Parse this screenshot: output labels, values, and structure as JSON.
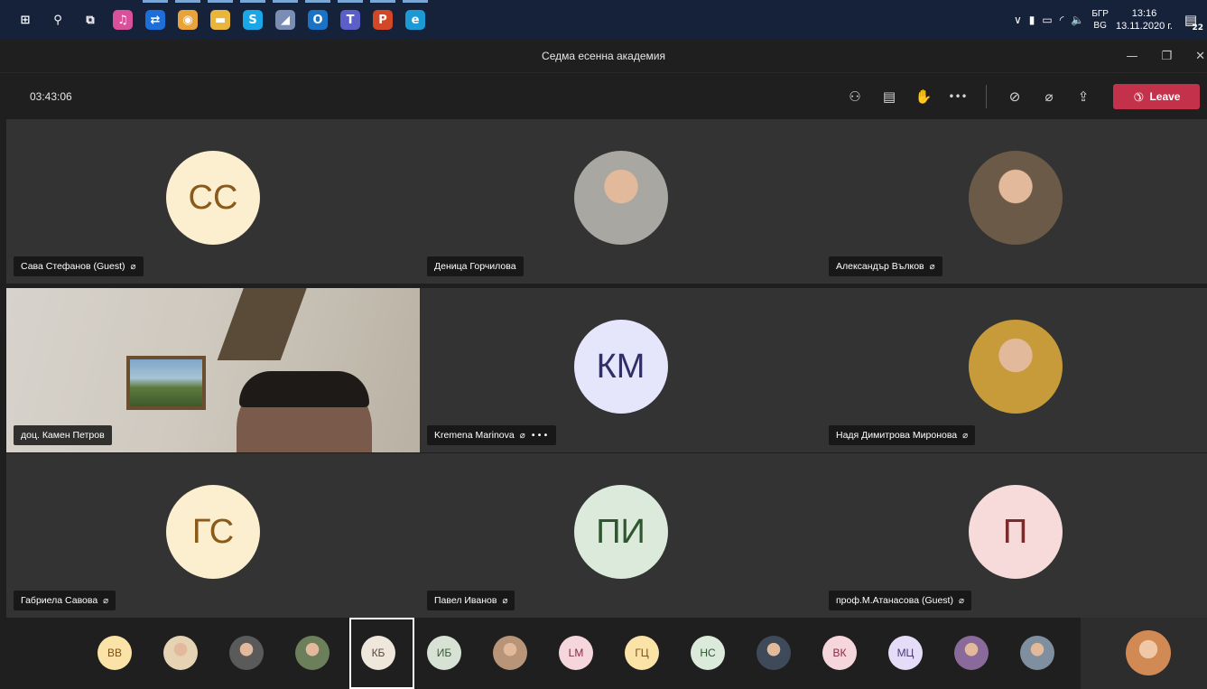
{
  "taskbar": {
    "apps": [
      {
        "icon": "windows-start-icon",
        "glyph": "⊞",
        "color": "transparent"
      },
      {
        "icon": "search-icon",
        "glyph": "⚲",
        "color": "transparent"
      },
      {
        "icon": "task-view-icon",
        "glyph": "⧉",
        "color": "transparent"
      },
      {
        "icon": "itunes-icon",
        "glyph": "♫",
        "color": "#d9509b"
      },
      {
        "icon": "teamviewer-icon",
        "glyph": "⇄",
        "color": "#1c6fd8"
      },
      {
        "icon": "chrome-icon",
        "glyph": "◉",
        "color": "#e8a33a"
      },
      {
        "icon": "file-explorer-icon",
        "glyph": "▬",
        "color": "#e9b53a"
      },
      {
        "icon": "skype-icon",
        "glyph": "S",
        "color": "#1aa7e8"
      },
      {
        "icon": "onenote-icon",
        "glyph": "◢",
        "color": "#7a8db5"
      },
      {
        "icon": "outlook-icon",
        "glyph": "O",
        "color": "#1c73c6"
      },
      {
        "icon": "teams-icon",
        "glyph": "T",
        "color": "#5b5fc7"
      },
      {
        "icon": "powerpoint-icon",
        "glyph": "P",
        "color": "#d24726"
      },
      {
        "icon": "edge-icon",
        "glyph": "e",
        "color": "#1c9ad6"
      }
    ],
    "running_indices": [
      4,
      5,
      6,
      7,
      8,
      9,
      10,
      11,
      12
    ],
    "tray": {
      "language_top": "БГР",
      "language_bottom": "BG",
      "time": "13:16",
      "date": "13.11.2020 г.",
      "notifications": "22"
    }
  },
  "window": {
    "title": "Седма есенна академия"
  },
  "meeting": {
    "timer": "03:43:06",
    "leave_label": "Leave",
    "tools": [
      {
        "name": "participants-icon",
        "glyph": "👥"
      },
      {
        "name": "chat-icon",
        "glyph": "☰"
      },
      {
        "name": "raise-hand-icon",
        "glyph": "✋"
      },
      {
        "name": "more-actions-icon",
        "glyph": "•••"
      }
    ],
    "controls": [
      {
        "name": "camera-off-icon",
        "glyph": "✕"
      },
      {
        "name": "mic-off-icon",
        "glyph": "🎙"
      },
      {
        "name": "share-screen-icon",
        "glyph": "⇪"
      }
    ]
  },
  "tiles": [
    {
      "name": "Сава Стефанов (Guest)",
      "initials": "СС",
      "bg": "#fbefcf",
      "fg": "#8a5a1b",
      "muted": true,
      "type": "initials"
    },
    {
      "name": "Деница Горчилова",
      "initials": "",
      "bg": "#a9a7a2",
      "fg": "#333",
      "muted": false,
      "type": "photo"
    },
    {
      "name": "Александър Вълков",
      "initials": "",
      "bg": "#6b5a48",
      "fg": "#fff",
      "muted": true,
      "type": "photo"
    },
    {
      "name": "доц. Камен Петров",
      "initials": "",
      "bg": "#c9c3b8",
      "fg": "#fff",
      "muted": false,
      "type": "video"
    },
    {
      "name": "Kremena Marinova",
      "initials": "КМ",
      "bg": "#e5e5fb",
      "fg": "#2f2f66",
      "muted": true,
      "more": true,
      "type": "initials"
    },
    {
      "name": "Надя Димитрова Миронова",
      "initials": "",
      "bg": "#c79a3a",
      "fg": "#fff",
      "muted": true,
      "type": "photo"
    },
    {
      "name": "Габриела Савова",
      "initials": "ГС",
      "bg": "#fbefcf",
      "fg": "#8a5a1b",
      "muted": true,
      "type": "initials"
    },
    {
      "name": "Павел Иванов",
      "initials": "ПИ",
      "bg": "#dbeadb",
      "fg": "#2e5631",
      "muted": true,
      "type": "initials"
    },
    {
      "name": "проф.М.Атанасова (Guest)",
      "initials": "П",
      "bg": "#f7dada",
      "fg": "#7a2b2b",
      "muted": true,
      "type": "initials"
    }
  ],
  "roster": [
    {
      "initials": "ВВ",
      "bg": "#fbe3a8",
      "fg": "#7a5214",
      "type": "initials"
    },
    {
      "initials": "",
      "bg": "#e6d3b3",
      "fg": "#333",
      "type": "photo"
    },
    {
      "initials": "",
      "bg": "#5a5a5a",
      "fg": "#fff",
      "type": "photo"
    },
    {
      "initials": "",
      "bg": "#6a7f5a",
      "fg": "#fff",
      "type": "photo"
    },
    {
      "initials": "КБ",
      "bg": "#efe7dc",
      "fg": "#5a4a3a",
      "type": "initials"
    },
    {
      "initials": "ИБ",
      "bg": "#d7e2d5",
      "fg": "#3c5a3a",
      "type": "initials"
    },
    {
      "initials": "",
      "bg": "#b89478",
      "fg": "#fff",
      "type": "photo"
    },
    {
      "initials": "LM",
      "bg": "#f6d6dd",
      "fg": "#8a2b42",
      "type": "initials"
    },
    {
      "initials": "ГЦ",
      "bg": "#fbe3a8",
      "fg": "#7a5214",
      "type": "initials"
    },
    {
      "initials": "НС",
      "bg": "#dbeadb",
      "fg": "#2e5631",
      "type": "initials"
    },
    {
      "initials": "",
      "bg": "#3e4a5a",
      "fg": "#fff",
      "type": "photo"
    },
    {
      "initials": "ВК",
      "bg": "#f6d6dd",
      "fg": "#8a2b42",
      "type": "initials"
    },
    {
      "initials": "МЦ",
      "bg": "#e5dcf7",
      "fg": "#4a3a7a",
      "type": "initials"
    },
    {
      "initials": "",
      "bg": "#8a6a9a",
      "fg": "#fff",
      "type": "photo"
    },
    {
      "initials": "",
      "bg": "#7f8fa0",
      "fg": "#fff",
      "type": "photo"
    }
  ],
  "self_view": {
    "bg": "#d28a55"
  }
}
